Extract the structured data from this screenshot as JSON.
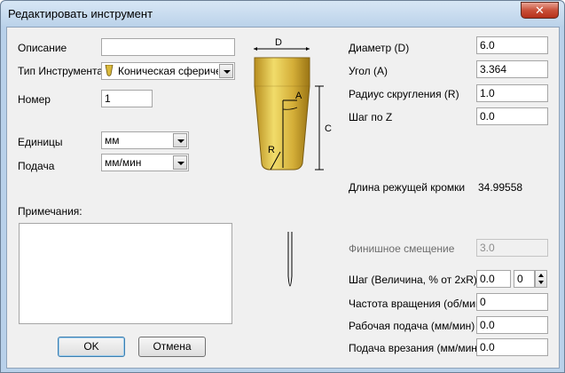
{
  "window": {
    "title": "Редактировать инструмент",
    "close_glyph": "✕"
  },
  "left": {
    "description": {
      "label": "Описание",
      "value": ""
    },
    "tool_type": {
      "label": "Тип Инструмента",
      "value": "Коническая сферичес"
    },
    "number": {
      "label": "Номер",
      "value": "1"
    },
    "units": {
      "label": "Единицы",
      "value": "мм"
    },
    "feed": {
      "label": "Подача",
      "value": "мм/мин"
    },
    "notes": {
      "label": "Примечания:"
    }
  },
  "diagram": {
    "label_d": "D",
    "label_a": "A",
    "label_c": "C",
    "label_r": "R",
    "tool_color": "#d9b93b"
  },
  "right": {
    "diameter": {
      "label": "Диаметр (D)",
      "value": "6.0"
    },
    "angle": {
      "label": "Угол (A)",
      "value": "3.364"
    },
    "radius": {
      "label": "Радиус скругления (R)",
      "value": "1.0"
    },
    "step_z": {
      "label": "Шаг по Z",
      "value": "0.0"
    },
    "cut_length": {
      "label": "Длина режущей кромки",
      "value": "34.99558"
    },
    "finish_offset": {
      "label": "Финишное смещение",
      "value": "3.0"
    },
    "step": {
      "label": "Шаг (Величина, % от 2xR)",
      "value": "0.0",
      "percent": "0"
    },
    "spindle": {
      "label": "Частота вращения (об/мин)",
      "value": "0"
    },
    "work_feed": {
      "label": "Рабочая подача (мм/мин)",
      "value": "0.0"
    },
    "plunge_feed": {
      "label": "Подача врезания (мм/мин)",
      "value": "0.0"
    }
  },
  "buttons": {
    "ok": "OK",
    "cancel": "Отмена"
  }
}
